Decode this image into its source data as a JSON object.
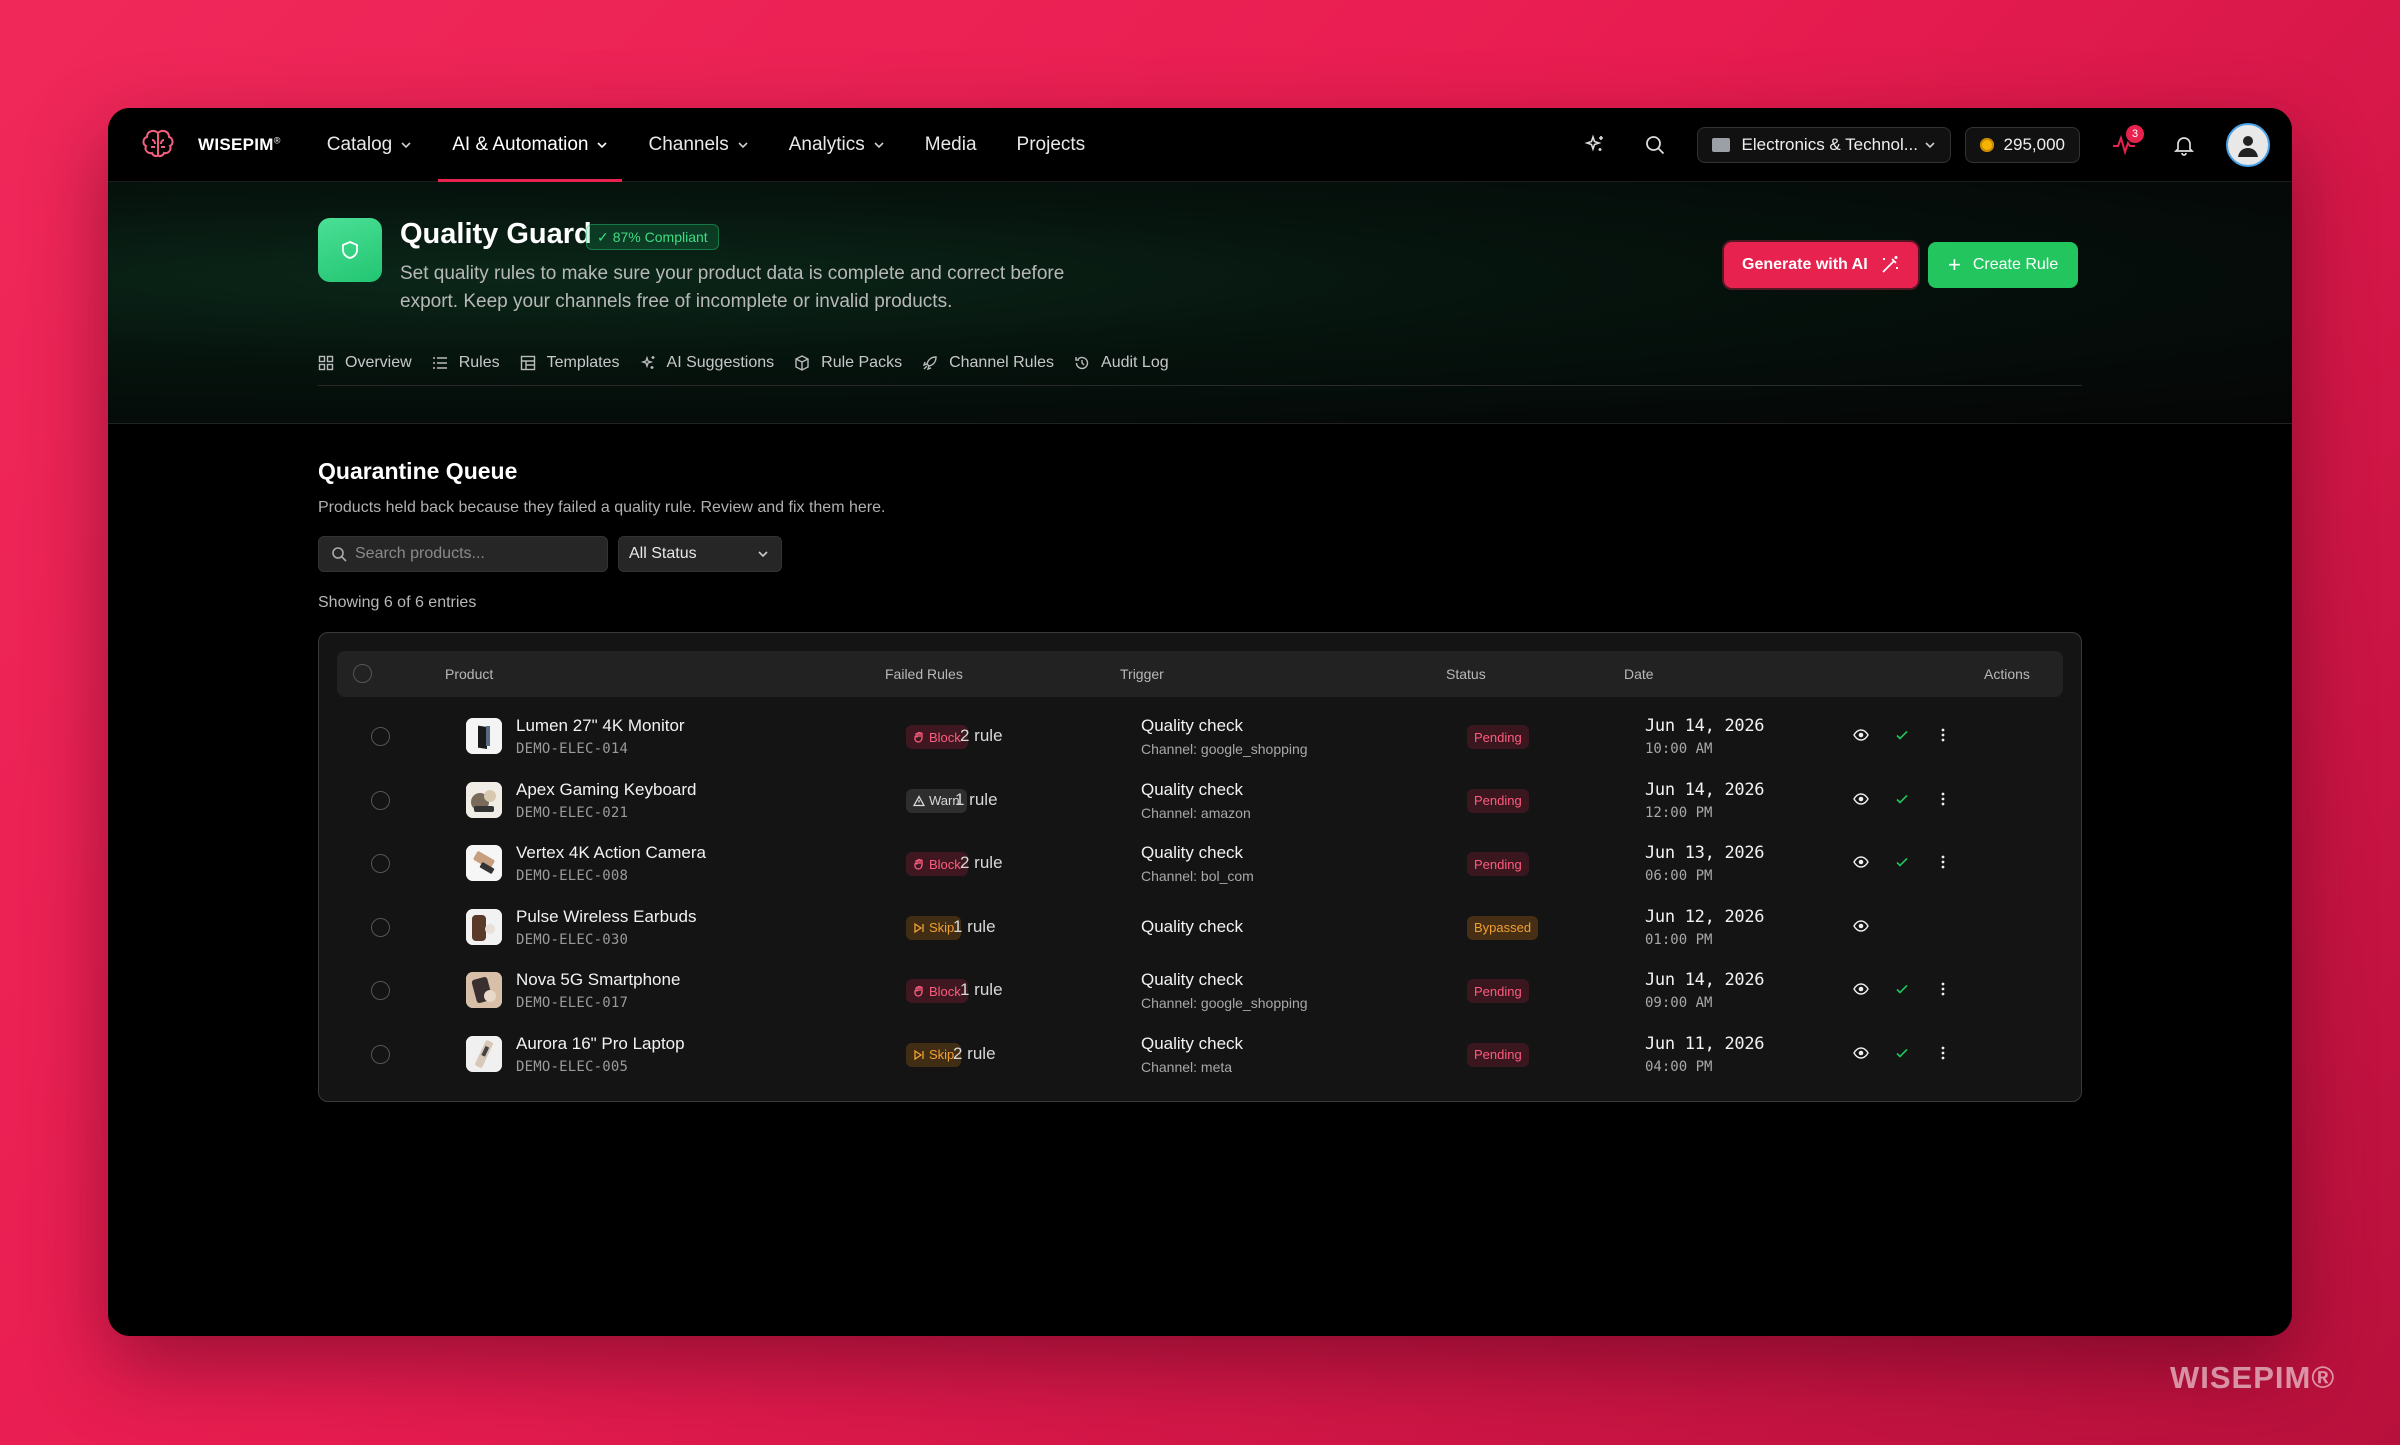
{
  "app": {
    "brand": "WISEPIM",
    "brand_mark": "®"
  },
  "nav": {
    "items": [
      {
        "label": "Catalog",
        "has_dropdown": true
      },
      {
        "label": "AI & Automation",
        "has_dropdown": true,
        "active": true
      },
      {
        "label": "Channels",
        "has_dropdown": true
      },
      {
        "label": "Analytics",
        "has_dropdown": true
      },
      {
        "label": "Media",
        "has_dropdown": false
      },
      {
        "label": "Projects",
        "has_dropdown": false
      }
    ]
  },
  "topbar": {
    "workspace": "Electronics & Technol...",
    "credits": "295,000",
    "activity_badge": "3"
  },
  "header": {
    "title": "Quality Guard",
    "compliance": "87% Compliant",
    "description": "Set quality rules to make sure your product data is complete and correct before export. Keep your channels free of incomplete or invalid products.",
    "generate_button": "Generate with AI",
    "create_button": "Create Rule",
    "tabs": [
      {
        "label": "Overview",
        "icon": "grid-icon"
      },
      {
        "label": "Rules",
        "icon": "list-icon"
      },
      {
        "label": "Templates",
        "icon": "template-icon"
      },
      {
        "label": "AI Suggestions",
        "icon": "sparkle-icon"
      },
      {
        "label": "Rule Packs",
        "icon": "package-icon"
      },
      {
        "label": "Channel Rules",
        "icon": "rocket-icon"
      },
      {
        "label": "Audit Log",
        "icon": "history-icon"
      }
    ]
  },
  "queue": {
    "title": "Quarantine Queue",
    "description": "Products held back because they failed a quality rule. Review and fix them here.",
    "search_placeholder": "Search products...",
    "status_filter": "All Status",
    "showing": "Showing 6 of 6 entries",
    "columns": {
      "product": "Product",
      "failed_rules": "Failed Rules",
      "trigger": "Trigger",
      "status": "Status",
      "date": "Date",
      "actions": "Actions"
    },
    "rows": [
      {
        "name": "Lumen 27\" 4K Monitor",
        "sku": "DEMO-ELEC-014",
        "severity": "Block",
        "rule_count": "2 rule",
        "trigger": "Quality check",
        "channel": "Channel: google_shopping",
        "status": "Pending",
        "date": "Jun 14, 2026",
        "time": "10:00 AM",
        "thumb": "monitor",
        "approvable": true
      },
      {
        "name": "Apex Gaming Keyboard",
        "sku": "DEMO-ELEC-021",
        "severity": "Warn",
        "rule_count": "1 rule",
        "trigger": "Quality check",
        "channel": "Channel: amazon",
        "status": "Pending",
        "date": "Jun 14, 2026",
        "time": "12:00 PM",
        "thumb": "keyboard",
        "approvable": true
      },
      {
        "name": "Vertex 4K Action Camera",
        "sku": "DEMO-ELEC-008",
        "severity": "Block",
        "rule_count": "2 rule",
        "trigger": "Quality check",
        "channel": "Channel: bol_com",
        "status": "Pending",
        "date": "Jun 13, 2026",
        "time": "06:00 PM",
        "thumb": "camera",
        "approvable": true
      },
      {
        "name": "Pulse Wireless Earbuds",
        "sku": "DEMO-ELEC-030",
        "severity": "Skip",
        "rule_count": "1 rule",
        "trigger": "Quality check",
        "channel": "",
        "status": "Bypassed",
        "date": "Jun 12, 2026",
        "time": "01:00 PM",
        "thumb": "earbuds",
        "approvable": false
      },
      {
        "name": "Nova 5G Smartphone",
        "sku": "DEMO-ELEC-017",
        "severity": "Block",
        "rule_count": "1 rule",
        "trigger": "Quality check",
        "channel": "Channel: google_shopping",
        "status": "Pending",
        "date": "Jun 14, 2026",
        "time": "09:00 AM",
        "thumb": "phone",
        "approvable": true
      },
      {
        "name": "Aurora 16\" Pro Laptop",
        "sku": "DEMO-ELEC-005",
        "severity": "Skip",
        "rule_count": "2 rule",
        "trigger": "Quality check",
        "channel": "Channel: meta",
        "status": "Pending",
        "date": "Jun 11, 2026",
        "time": "04:00 PM",
        "thumb": "laptop",
        "approvable": true
      }
    ]
  },
  "watermark": "WISEPIM®",
  "colors": {
    "accent": "#e8224f",
    "success": "#22c55e",
    "background": "#000000"
  }
}
